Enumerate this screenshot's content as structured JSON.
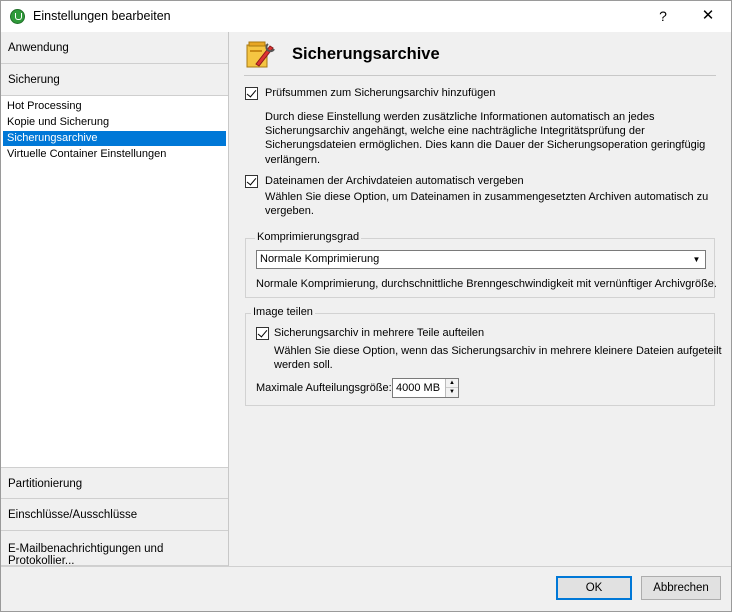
{
  "window": {
    "title": "Einstellungen bearbeiten",
    "help_label": "?",
    "close_label": "✕"
  },
  "sidebar": {
    "top_categories": [
      {
        "label": "Anwendung"
      },
      {
        "label": "Sicherung"
      }
    ],
    "sub_items": [
      {
        "label": "Hot Processing",
        "selected": false
      },
      {
        "label": "Kopie und Sicherung",
        "selected": false
      },
      {
        "label": "Sicherungsarchive",
        "selected": true
      },
      {
        "label": "Virtuelle Container Einstellungen",
        "selected": false
      }
    ],
    "bottom_categories": [
      {
        "label": "Partitionierung"
      },
      {
        "label": "Einschlüsse/Ausschlüsse"
      },
      {
        "label": "E-Mailbenachrichtigungen und Protokollier..."
      }
    ]
  },
  "main": {
    "title": "Sicherungsarchive",
    "header_icon": "archive-settings-icon",
    "checksum": {
      "checked": true,
      "label": "Prüfsummen zum Sicherungsarchiv hinzufügen",
      "desc": [
        "Durch diese Einstellung werden zusätzliche Informationen automatisch an jedes",
        "Sicherungsarchiv angehängt, welche eine nachträgliche Integritätsprüfung der",
        "Sicherungsdateien ermöglichen. Dies kann die Dauer der Sicherungsoperation geringfügig",
        "verlängern."
      ]
    },
    "auto_names": {
      "checked": true,
      "label": "Dateinamen der Archivdateien automatisch vergeben",
      "desc": [
        "Wählen Sie diese Option, um Dateinamen in zusammengesetzten Archiven automatisch zu",
        "vergeben."
      ]
    },
    "compression": {
      "group_title": "Komprimierungsgrad",
      "selected": "Normale Komprimierung",
      "desc": "Normale Komprimierung, durchschnittliche Brenngeschwindigkeit mit vernünftiger Archivgröße."
    },
    "split": {
      "group_title": "Image teilen",
      "checked": true,
      "label": "Sicherungsarchiv in mehrere Teile aufteilen",
      "desc": [
        "Wählen Sie diese Option, wenn das Sicherungsarchiv in mehrere kleinere Dateien aufgeteilt",
        "werden soll."
      ],
      "max_size_label": "Maximale Aufteilungsgröße:",
      "max_size_value": "4000 MB"
    }
  },
  "footer": {
    "ok_label": "OK",
    "cancel_label": "Abbrechen"
  },
  "colors": {
    "selection": "#0078d7",
    "window_bg": "#f0f0f0"
  }
}
